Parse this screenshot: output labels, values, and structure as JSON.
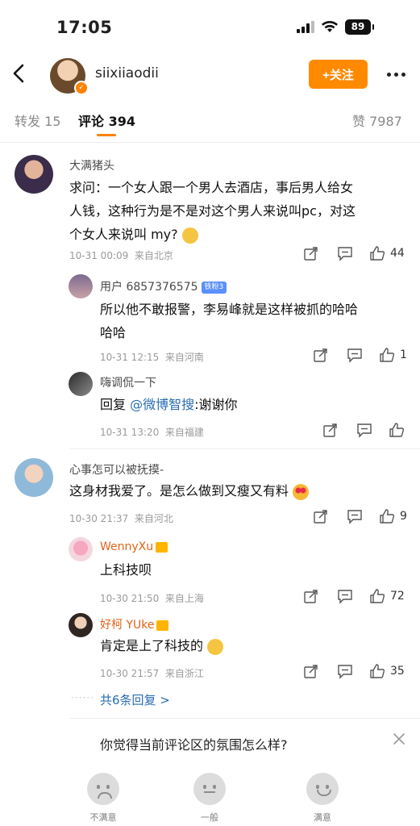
{
  "status_bar": {
    "time": "17:05",
    "battery": "89"
  },
  "header": {
    "username": "siixiiaodii",
    "follow_label": "+关注"
  },
  "tabs": {
    "repost": "转发 15",
    "comments": "评论 394",
    "likes": "赞 7987"
  },
  "comments": [
    {
      "user": "大满猪头",
      "text_line1": "求问：一个女人跟一个男人去酒店，事后男人给女",
      "text_line2": "人钱，这种行为是不是对这个男人来说叫pc，对这",
      "text_line3": "个女人来说叫 my?",
      "time": "10-31 00:09",
      "location": "来自北京",
      "likes": "44",
      "replies": [
        {
          "user": "用户 6857376575",
          "badge": "铁粉3",
          "text_line1": "所以他不敢报警，李易峰就是这样被抓的哈哈",
          "text_line2": "哈哈",
          "time": "10-31 12:15",
          "location": "来自河南",
          "likes": "1"
        },
        {
          "user": "嗨调侃一下",
          "reply_prefix": "回复",
          "reply_to": "@微博智搜",
          "text": ":谢谢你",
          "time": "10-31 13:20",
          "location": "来自福建"
        }
      ]
    },
    {
      "user": "心事怎可以被抚摸-",
      "text": "这身材我爱了。是怎么做到又瘦又有料",
      "time": "10-30 21:37",
      "location": "来自河北",
      "likes": "9",
      "replies": [
        {
          "user": "WennyXu",
          "text": "上科技呗",
          "time": "10-30 21:50",
          "location": "来自上海",
          "likes": "72"
        },
        {
          "user": "好柯 YUke",
          "text": "肯定是上了科技的",
          "time": "10-30 21:57",
          "location": "来自浙江",
          "likes": "35"
        }
      ],
      "more_replies": "共6条回复 >"
    }
  ],
  "survey": {
    "question": "你觉得当前评论区的氛围怎么样?",
    "options": [
      "不满意",
      "一般",
      "满意"
    ]
  },
  "colors": {
    "accent": "#ff8200",
    "link": "#2a6db2"
  },
  "icons": [
    "back-icon",
    "more-icon",
    "share-icon",
    "comment-icon",
    "like-icon",
    "close-icon"
  ]
}
